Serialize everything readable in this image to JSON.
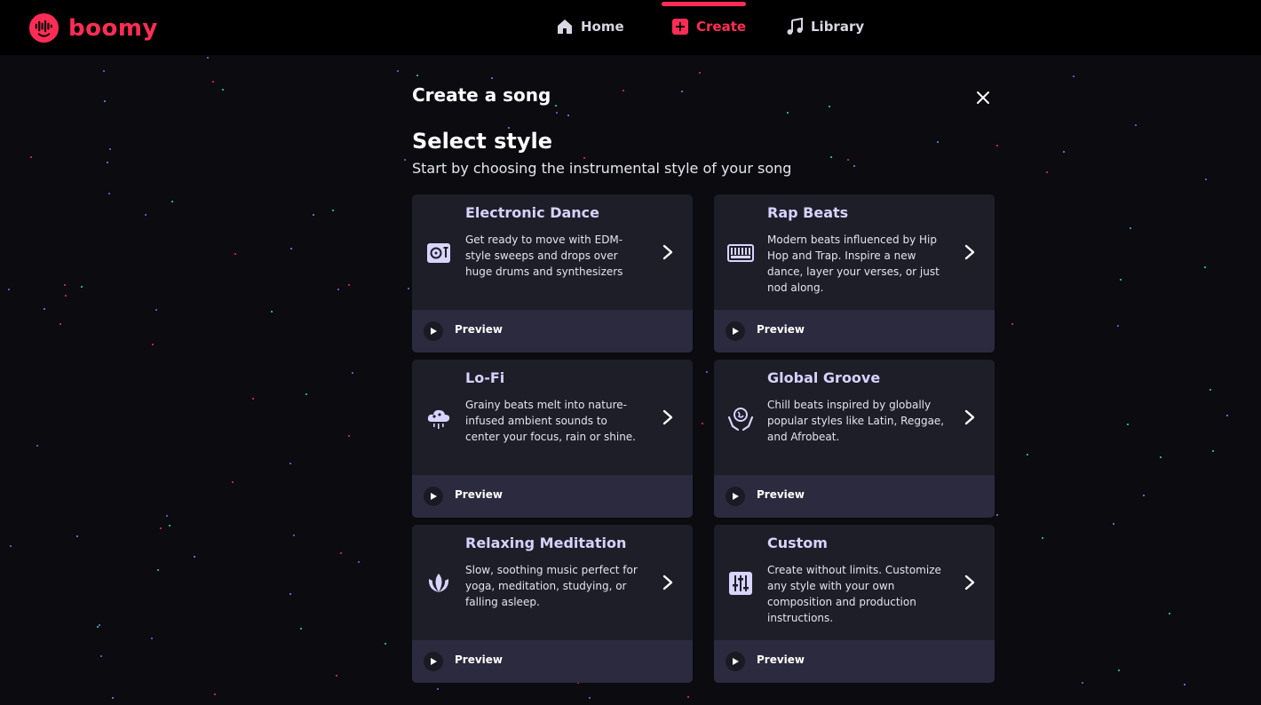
{
  "brand": {
    "name": "boomy",
    "color": "#ff2d55"
  },
  "nav": {
    "items": [
      {
        "label": "Home",
        "icon": "home-icon",
        "active": false
      },
      {
        "label": "Create",
        "icon": "plus-square-icon",
        "active": true
      },
      {
        "label": "Library",
        "icon": "music-note-icon",
        "active": false
      }
    ]
  },
  "dialog": {
    "title": "Create a song",
    "close_icon": "close-icon",
    "section_title": "Select style",
    "section_subtitle": "Start by choosing the instrumental style of your song"
  },
  "styles": [
    {
      "title": "Electronic Dance",
      "description": "Get ready to move with EDM-style sweeps and drops over huge drums and synthesizers",
      "icon": "turntable-icon",
      "preview_label": "Preview"
    },
    {
      "title": "Rap Beats",
      "description": "Modern beats influenced by Hip Hop and Trap. Inspire a new dance, layer your verses, or just nod along.",
      "icon": "keyboard-icon",
      "preview_label": "Preview"
    },
    {
      "title": "Lo-Fi",
      "description": "Grainy beats melt into nature-infused ambient sounds to center your focus, rain or shine.",
      "icon": "rain-cloud-icon",
      "preview_label": "Preview"
    },
    {
      "title": "Global Groove",
      "description": "Chill beats inspired by globally popular styles like Latin, Reggae, and Afrobeat.",
      "icon": "globe-hands-icon",
      "preview_label": "Preview"
    },
    {
      "title": "Relaxing Meditation",
      "description": "Slow, soothing music perfect for yoga, meditation, studying, or falling asleep.",
      "icon": "lotus-icon",
      "preview_label": "Preview"
    },
    {
      "title": "Custom",
      "description": "Create without limits. Customize any style with your own composition and production instructions.",
      "icon": "mixer-sliders-icon",
      "preview_label": "Preview"
    }
  ],
  "colors": {
    "accent": "#ff2d55",
    "card_bg": "#1e1e28",
    "card_footer_bg": "#2c2a3e",
    "card_title": "#d6d2ff",
    "icon_fill": "#d8d4ff"
  }
}
